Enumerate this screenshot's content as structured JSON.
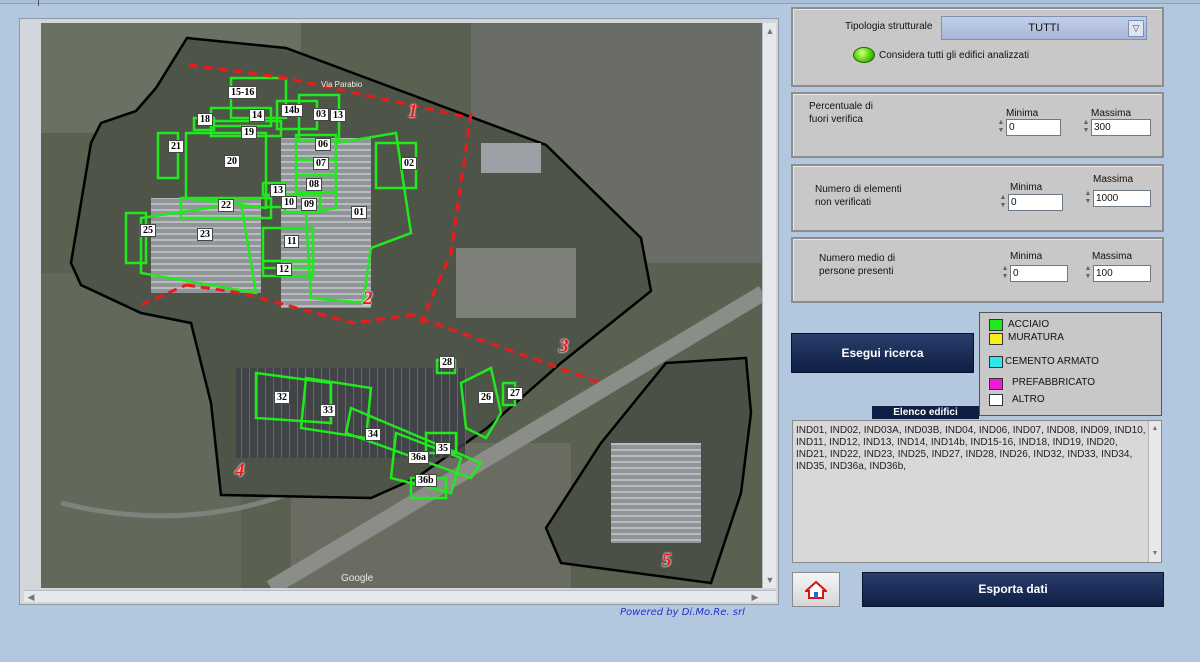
{
  "map": {
    "powered_by": "Powered by Di.Mo.Re. srl",
    "street_label": "Via Parabio",
    "google_label": "Google",
    "zones": [
      "1",
      "2",
      "3",
      "4",
      "5"
    ],
    "buildings": [
      "15-16",
      "14",
      "14b",
      "03",
      "13",
      "18",
      "19",
      "21",
      "20",
      "06",
      "02",
      "07",
      "08",
      "13",
      "10",
      "09",
      "01",
      "22",
      "25",
      "23",
      "11",
      "12",
      "28",
      "26",
      "27",
      "32",
      "33",
      "34",
      "36a",
      "35",
      "36b"
    ]
  },
  "filters": {
    "tipologia_label": "Tipologia strutturale",
    "tipologia_value": "TUTTI",
    "considera_label": "Considera tutti gli edifici analizzati",
    "min_label": "Minima",
    "max_label": "Massima",
    "percentuale": {
      "label_line1": "Percentuale di",
      "label_line2": "fuori verifica",
      "min": "0",
      "max": "300"
    },
    "elementi": {
      "label_line1": "Numero di elementi",
      "label_line2": "non verificati",
      "min": "0",
      "max": "1000"
    },
    "persone": {
      "label_line1": "Numero medio di",
      "label_line2": "persone presenti",
      "min": "0",
      "max": "100"
    }
  },
  "actions": {
    "search_label": "Esegui ricerca",
    "export_label": "Esporta dati"
  },
  "legend": [
    {
      "label": "ACCIAIO",
      "color": "#22e81e"
    },
    {
      "label": "MURATURA",
      "color": "#f5f01a"
    },
    {
      "label": "CEMENTO ARMATO",
      "color": "#2ee6ee"
    },
    {
      "label": "PREFABBRICATO",
      "color": "#f01adc"
    },
    {
      "label": "ALTRO",
      "color": "#ffffff"
    }
  ],
  "elenco": {
    "title": "Elenco edifici",
    "text": "IND01, IND02, IND03A, IND03B, IND04, IND06, IND07, IND08, IND09, IND10, IND11, IND12, IND13, IND14, IND14b, IND15-16, IND18, IND19, IND20, IND21, IND22, IND23, IND25, IND27, IND28, IND26, IND32, IND33, IND34, IND35, IND36a, IND36b,"
  }
}
